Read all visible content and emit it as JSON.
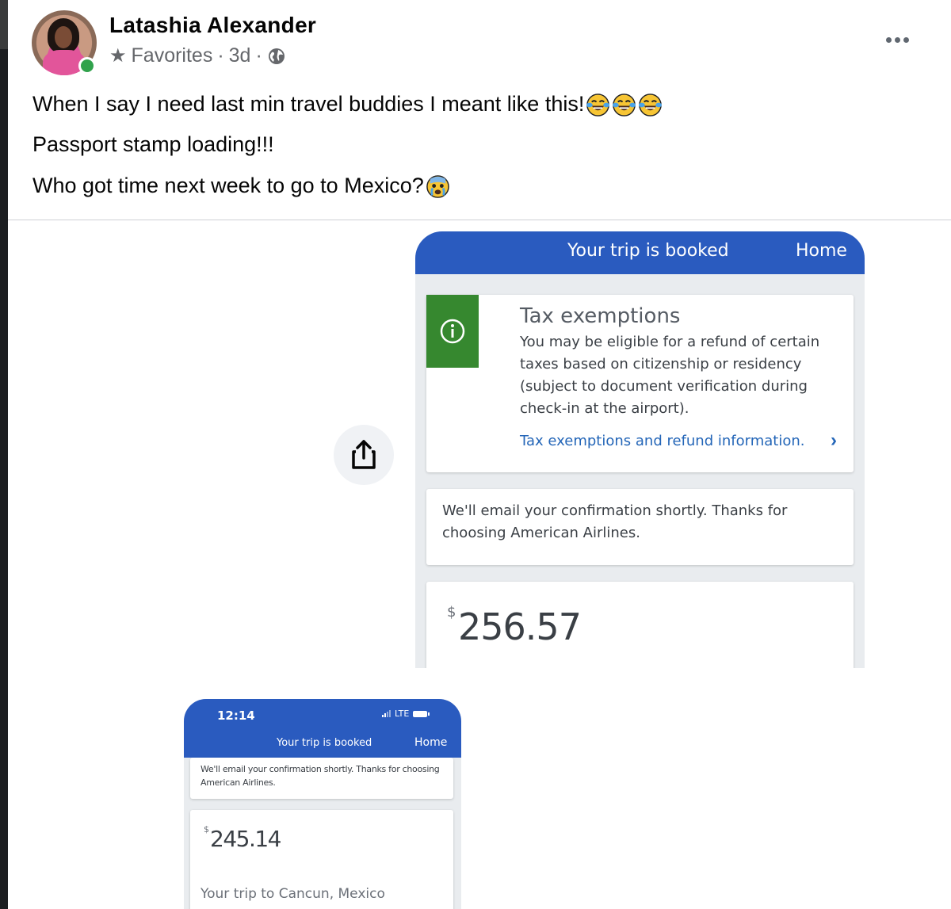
{
  "post": {
    "author": "Latashia Alexander",
    "audience": "Favorites",
    "separator": "·",
    "time_ago": "3d",
    "lines": [
      "When I say I need last min travel buddies I meant like this!",
      "Passport stamp loading!!!",
      "Who got time next week to go to Mexico?"
    ],
    "emojis_line1": [
      "tears-of-joy-emoji",
      "tears-of-joy-emoji",
      "tears-of-joy-emoji"
    ],
    "emoji_line3": "crying-face-emoji"
  },
  "screenshot_large": {
    "header_title": "Your trip is booked",
    "header_home": "Home",
    "tax_title": "Tax exemptions",
    "tax_body": "You may be eligible for a refund of certain taxes based on citizenship or residency (subject to document verification during check-in at the airport).",
    "tax_link": "Tax exemptions and refund information.",
    "email_text": "We'll email your confirmation shortly. Thanks for choosing American Airlines.",
    "currency": "$",
    "price": "256.57",
    "accent_color": "#2a5bbf",
    "info_color": "#36882f"
  },
  "screenshot_small": {
    "time": "12:14",
    "network": "LTE",
    "header_title": "Your trip is booked",
    "header_home": "Home",
    "email_text": "We'll email your confirmation shortly. Thanks for choosing American Airlines.",
    "currency": "$",
    "price": "245.14",
    "trip_label": "Your trip to Cancun, Mexico"
  }
}
